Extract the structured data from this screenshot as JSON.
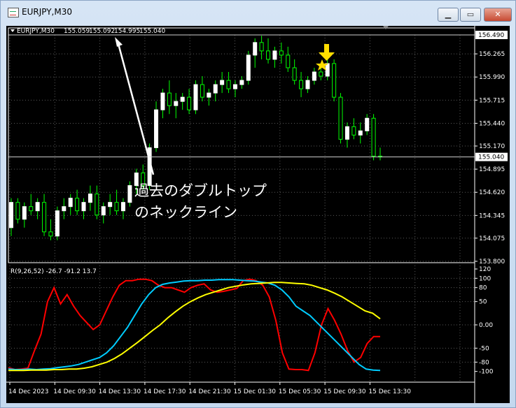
{
  "window": {
    "title": "EURJPY,M30",
    "buttons": {
      "minimize": "▁",
      "maximize": "▭",
      "close": "✕"
    }
  },
  "header": {
    "symbol_label": "EURJPY,M30",
    "ohlc": [
      "155.059",
      "155.092",
      "154.995",
      "155.040"
    ]
  },
  "annotation": {
    "line1": "過去のダブルトップ",
    "line2": "のネックライン"
  },
  "rci_header": "R(9,26,52) -26.7 -91.2 13.7",
  "colors": {
    "background": "#000000",
    "bull_candle": "#ffffff",
    "wick": "#00ff00",
    "grid": "#5a5a5a",
    "rci_short": "#ff0000",
    "rci_mid": "#00ccff",
    "rci_long": "#ffff00",
    "marker": "#ffdd00"
  },
  "chart_data": [
    {
      "type": "candlestick",
      "title": "EURJPY,M30",
      "ylim": [
        153.8,
        156.49
      ],
      "y_ticks": [
        "156.265",
        "155.990",
        "155.715",
        "155.440",
        "155.170",
        "154.895",
        "154.620",
        "154.345",
        "154.075",
        "153.800"
      ],
      "price_labels": [
        "156.490",
        "155.040"
      ],
      "horizontal_lines": [
        156.49,
        155.04
      ],
      "x_ticks": [
        "14 Dec 2023",
        "14 Dec 09:30",
        "14 Dec 13:30",
        "14 Dec 17:30",
        "14 Dec 21:30",
        "15 Dec 01:30",
        "15 Dec 05:30",
        "15 Dec 09:30",
        "15 Dec 13:30"
      ],
      "candles": [
        [
          154.2,
          154.55,
          154.1,
          154.5
        ],
        [
          154.5,
          154.55,
          154.25,
          154.3
        ],
        [
          154.3,
          154.5,
          154.2,
          154.45
        ],
        [
          154.45,
          154.6,
          154.35,
          154.4
        ],
        [
          154.4,
          154.55,
          154.3,
          154.5
        ],
        [
          154.5,
          154.6,
          154.1,
          154.15
        ],
        [
          154.15,
          154.3,
          154.05,
          154.1
        ],
        [
          154.1,
          154.45,
          154.05,
          154.4
        ],
        [
          154.4,
          154.55,
          154.3,
          154.45
        ],
        [
          154.45,
          154.6,
          154.35,
          154.55
        ],
        [
          154.55,
          154.65,
          154.35,
          154.4
        ],
        [
          154.4,
          154.55,
          154.3,
          154.5
        ],
        [
          154.5,
          154.7,
          154.4,
          154.6
        ],
        [
          154.6,
          154.7,
          154.3,
          154.35
        ],
        [
          154.35,
          154.5,
          154.25,
          154.45
        ],
        [
          154.45,
          154.6,
          154.35,
          154.5
        ],
        [
          154.5,
          154.65,
          154.35,
          154.4
        ],
        [
          154.4,
          154.55,
          154.3,
          154.5
        ],
        [
          154.5,
          154.75,
          154.45,
          154.7
        ],
        [
          154.7,
          154.9,
          154.6,
          154.85
        ],
        [
          154.85,
          154.95,
          154.65,
          154.7
        ],
        [
          154.7,
          155.2,
          154.65,
          155.15
        ],
        [
          155.15,
          155.7,
          155.1,
          155.6
        ],
        [
          155.6,
          155.85,
          155.5,
          155.8
        ],
        [
          155.8,
          155.95,
          155.55,
          155.65
        ],
        [
          155.65,
          155.8,
          155.5,
          155.7
        ],
        [
          155.7,
          155.8,
          155.6,
          155.75
        ],
        [
          155.75,
          155.85,
          155.55,
          155.6
        ],
        [
          155.6,
          155.95,
          155.55,
          155.9
        ],
        [
          155.9,
          156.0,
          155.7,
          155.75
        ],
        [
          155.75,
          155.85,
          155.65,
          155.8
        ],
        [
          155.8,
          155.95,
          155.7,
          155.9
        ],
        [
          155.9,
          156.05,
          155.8,
          155.95
        ],
        [
          155.95,
          156.05,
          155.8,
          155.85
        ],
        [
          155.85,
          155.95,
          155.75,
          155.9
        ],
        [
          155.9,
          156.0,
          155.85,
          155.95
        ],
        [
          155.95,
          156.3,
          155.9,
          156.25
        ],
        [
          156.25,
          156.45,
          156.1,
          156.4
        ],
        [
          156.4,
          156.48,
          156.2,
          156.3
        ],
        [
          156.3,
          156.45,
          156.15,
          156.2
        ],
        [
          156.2,
          156.35,
          156.1,
          156.3
        ],
        [
          156.3,
          156.4,
          156.15,
          156.25
        ],
        [
          156.25,
          156.35,
          156.05,
          156.1
        ],
        [
          156.1,
          156.2,
          155.9,
          155.95
        ],
        [
          155.95,
          156.05,
          155.75,
          155.85
        ],
        [
          155.85,
          156.0,
          155.8,
          155.95
        ],
        [
          155.95,
          156.1,
          155.9,
          156.05
        ],
        [
          156.05,
          156.15,
          155.95,
          156.0
        ],
        [
          156.0,
          156.2,
          155.95,
          156.15
        ],
        [
          156.15,
          156.2,
          155.7,
          155.75
        ],
        [
          155.75,
          155.8,
          155.2,
          155.25
        ],
        [
          155.25,
          155.45,
          155.15,
          155.4
        ],
        [
          155.4,
          155.5,
          155.25,
          155.3
        ],
        [
          155.3,
          155.45,
          155.2,
          155.35
        ],
        [
          155.35,
          155.55,
          155.3,
          155.5
        ],
        [
          155.5,
          155.55,
          155.0,
          155.05
        ],
        [
          155.05,
          155.15,
          155.0,
          155.04
        ]
      ]
    },
    {
      "type": "line",
      "title": "R(9,26,52)",
      "ylim": [
        -120,
        120
      ],
      "y_ticks": [
        "120",
        "100",
        "80",
        "50",
        "0.00",
        "-50",
        "-80",
        "-100"
      ],
      "series": [
        {
          "name": "R(9)",
          "color": "#ff0000",
          "values": [
            -92,
            -96,
            -95,
            -93,
            -55,
            -20,
            50,
            80,
            45,
            65,
            40,
            20,
            5,
            -10,
            0,
            30,
            60,
            85,
            95,
            95,
            98,
            98,
            95,
            85,
            80,
            80,
            75,
            70,
            80,
            85,
            88,
            75,
            70,
            72,
            75,
            78,
            95,
            98,
            95,
            85,
            60,
            10,
            -60,
            -95,
            -96,
            -96,
            -98,
            -60,
            0,
            35,
            10,
            -20,
            -55,
            -80,
            -70,
            -40,
            -25,
            -25
          ]
        },
        {
          "name": "R(26)",
          "color": "#00ccff",
          "values": [
            -95,
            -96,
            -96,
            -95,
            -96,
            -95,
            -94,
            -92,
            -90,
            -88,
            -85,
            -80,
            -75,
            -70,
            -60,
            -45,
            -25,
            -5,
            20,
            45,
            65,
            80,
            87,
            90,
            92,
            94,
            95,
            95,
            96,
            96,
            97,
            97,
            97,
            96,
            95,
            94,
            92,
            90,
            85,
            75,
            60,
            40,
            30,
            20,
            5,
            -10,
            -25,
            -40,
            -55,
            -70,
            -85,
            -95,
            -97,
            -98
          ]
        },
        {
          "name": "R(52)",
          "color": "#ffff00",
          "values": [
            -98,
            -98,
            -98,
            -97,
            -97,
            -97,
            -96,
            -96,
            -95,
            -95,
            -93,
            -90,
            -85,
            -80,
            -72,
            -62,
            -50,
            -38,
            -25,
            -12,
            0,
            15,
            28,
            40,
            50,
            58,
            65,
            70,
            75,
            80,
            83,
            86,
            88,
            89,
            90,
            91,
            91,
            90,
            89,
            88,
            85,
            80,
            75,
            68,
            60,
            50,
            40,
            30,
            25,
            13
          ]
        }
      ]
    }
  ]
}
